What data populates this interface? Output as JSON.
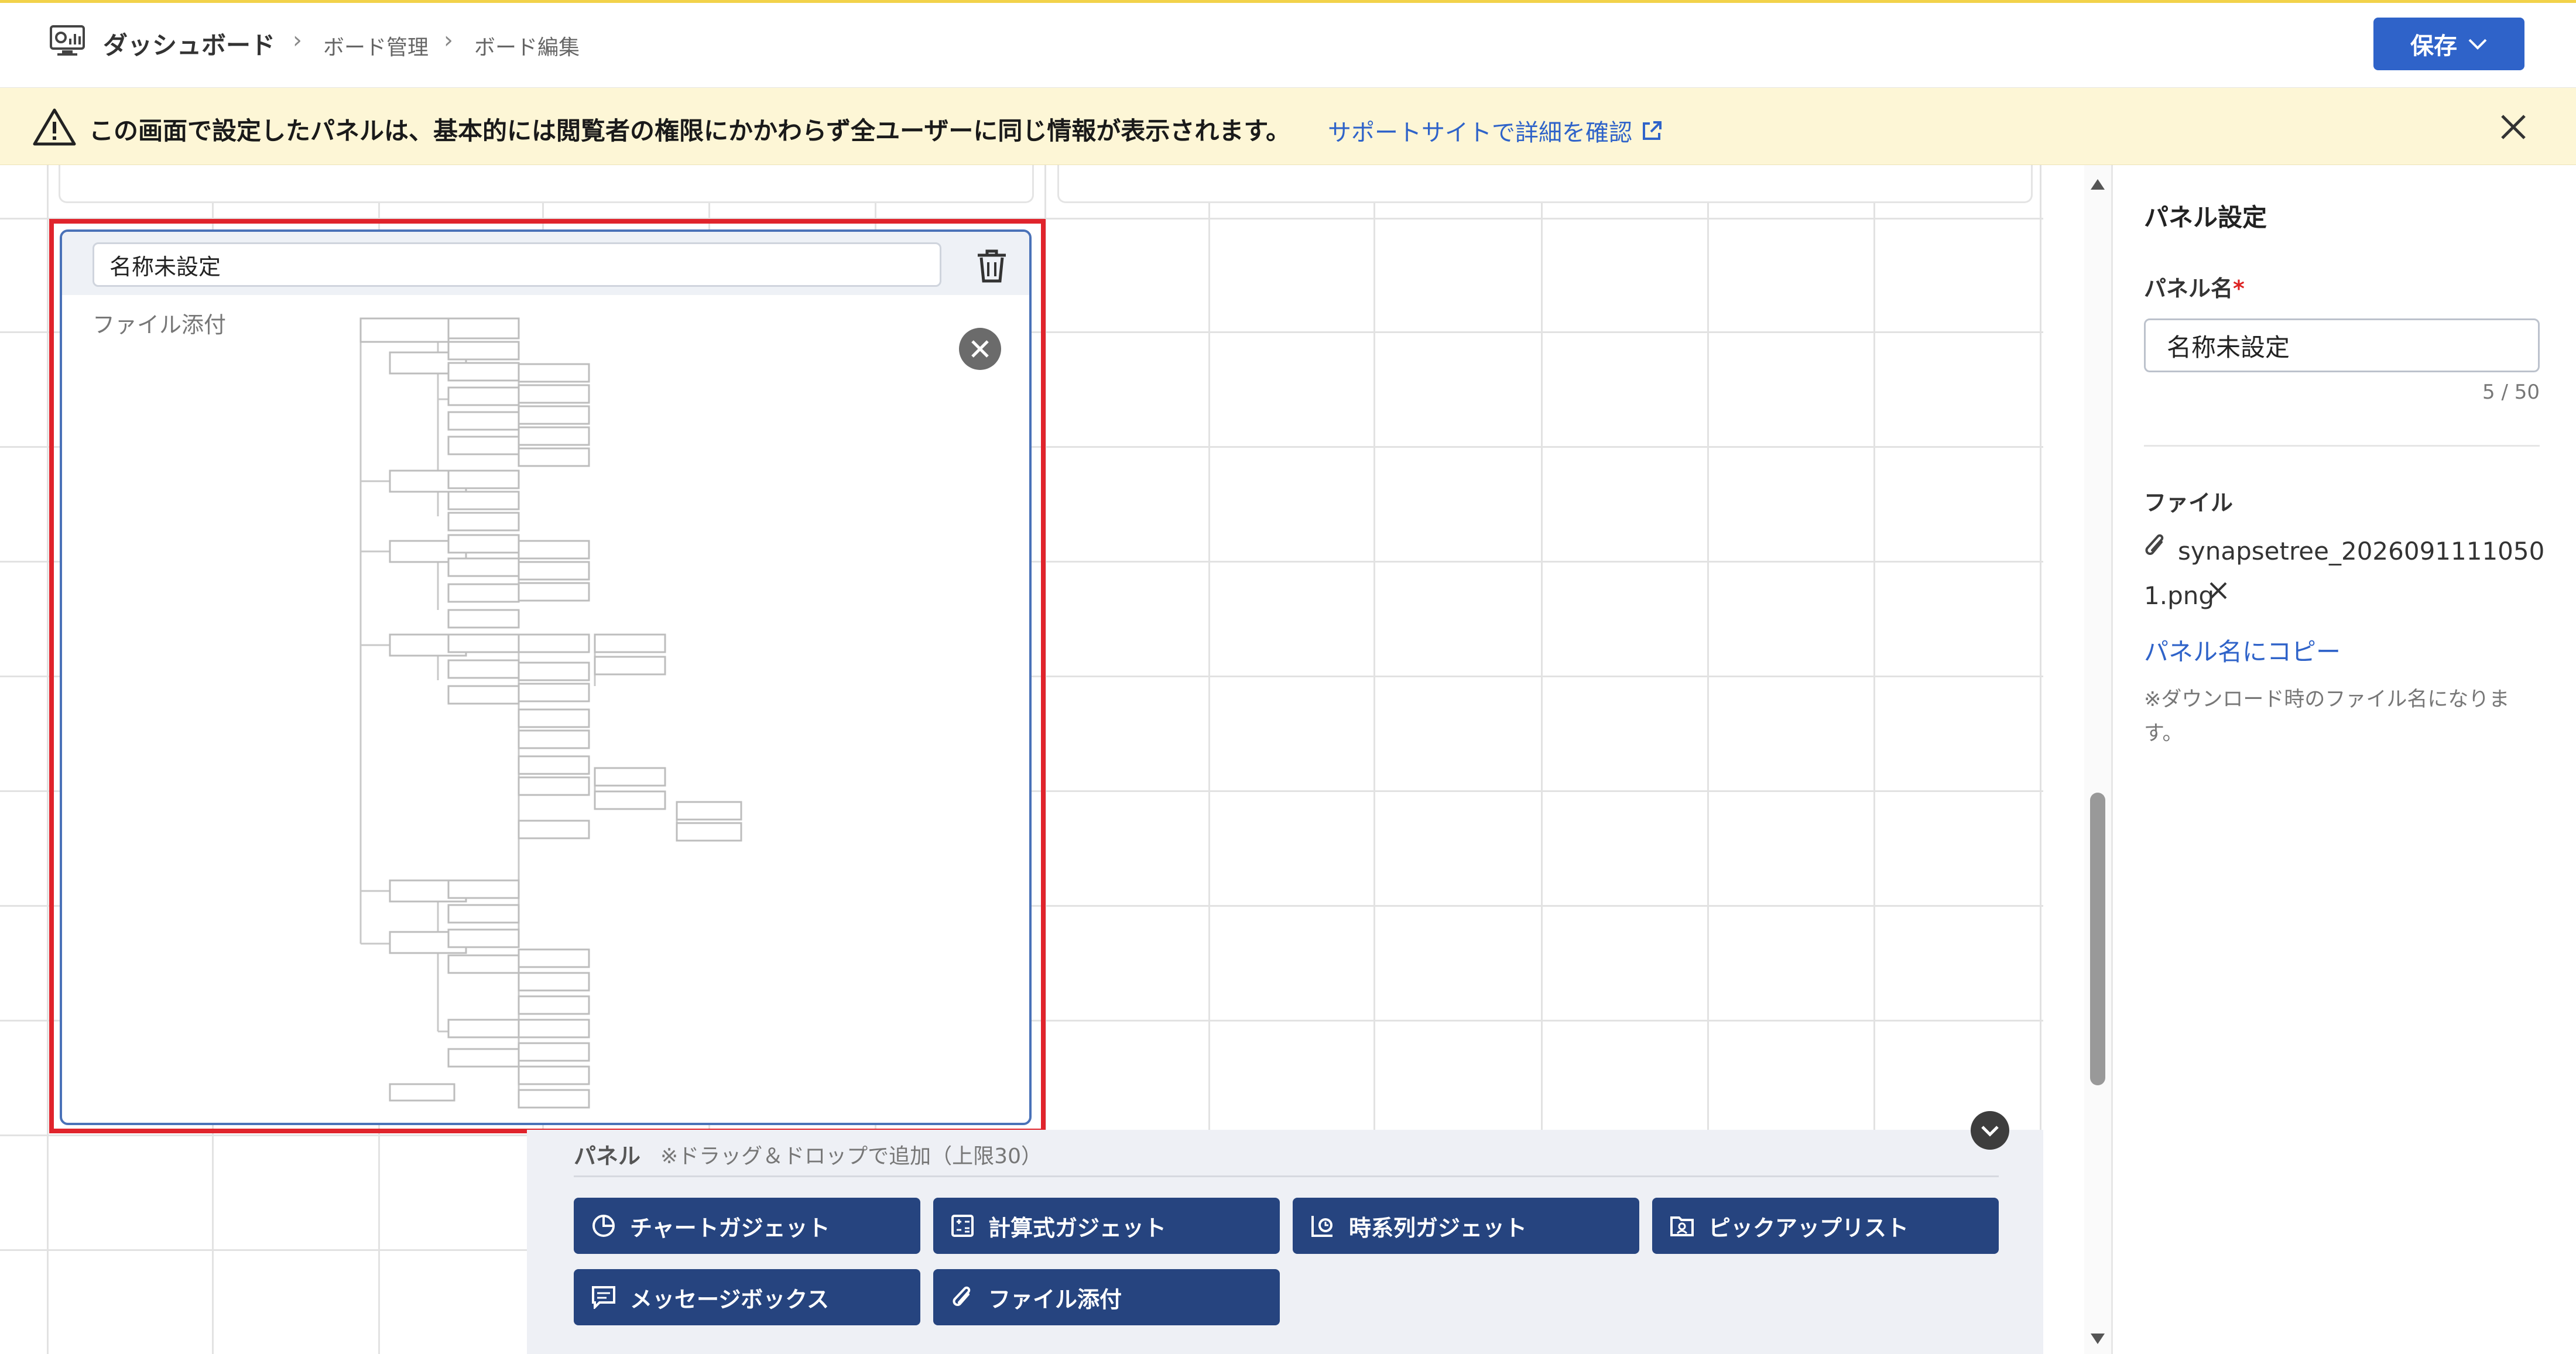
{
  "header": {
    "title": "ダッシュボード",
    "breadcrumb": [
      "ボード管理",
      "ボード編集"
    ],
    "save_label": "保存"
  },
  "notice": {
    "text": "この画面で設定したパネルは、基本的には閲覧者の権限にかかわらず全ユーザーに同じ情報が表示されます。",
    "link_label": "サポートサイトで詳細を確認"
  },
  "panel": {
    "name_value": "名称未設定",
    "type_label": "ファイル添付"
  },
  "drawer": {
    "title": "パネル",
    "hint": "※ドラッグ＆ドロップで追加（上限30）",
    "gadgets": [
      {
        "label": "チャートガジェット",
        "icon": "chart-icon"
      },
      {
        "label": "計算式ガジェット",
        "icon": "calculator-icon"
      },
      {
        "label": "時系列ガジェット",
        "icon": "timeseries-icon"
      },
      {
        "label": "ピックアップリスト",
        "icon": "pickup-icon"
      },
      {
        "label": "メッセージボックス",
        "icon": "message-icon"
      },
      {
        "label": "ファイル添付",
        "icon": "paperclip-icon"
      }
    ]
  },
  "side_panel": {
    "title": "パネル設定",
    "name_label": "パネル名",
    "required_mark": "*",
    "name_value": "名称未設定",
    "char_count": "5 / 50",
    "file_label": "ファイル",
    "file_name": "synapsetree_20260911110501.png",
    "copy_link": "パネル名にコピー",
    "note": "※ダウンロード時のファイル名になります。"
  },
  "colors": {
    "primary": "#2f63c9",
    "gadget_button": "#26447f",
    "notice_background": "#fdf6d6",
    "selection_border": "#e0242c"
  }
}
